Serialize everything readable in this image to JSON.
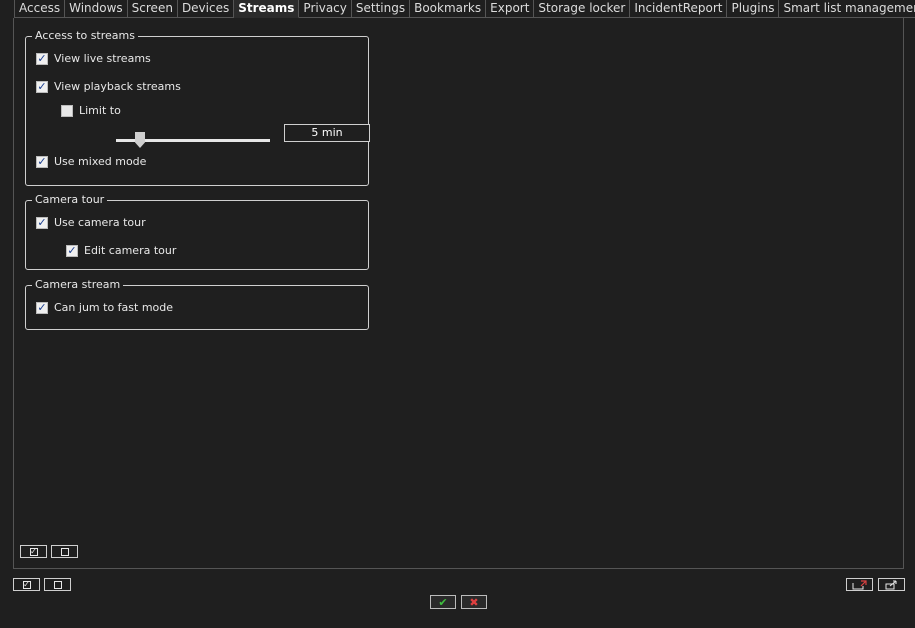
{
  "tabs": [
    {
      "label": "Access"
    },
    {
      "label": "Windows"
    },
    {
      "label": "Screen"
    },
    {
      "label": "Devices"
    },
    {
      "label": "Streams",
      "active": true
    },
    {
      "label": "Privacy"
    },
    {
      "label": "Settings"
    },
    {
      "label": "Bookmarks"
    },
    {
      "label": "Export"
    },
    {
      "label": "Storage locker"
    },
    {
      "label": "IncidentReport"
    },
    {
      "label": "Plugins"
    },
    {
      "label": "Smart list management"
    }
  ],
  "groups": {
    "access_to_streams": {
      "title": "Access to streams",
      "view_live": {
        "label": "View live streams",
        "checked": true
      },
      "view_playback": {
        "label": "View playback streams",
        "checked": true
      },
      "limit_to": {
        "label": "Limit to",
        "checked": false
      },
      "limit_value": "5 min",
      "mixed_mode": {
        "label": "Use mixed mode",
        "checked": true
      }
    },
    "camera_tour": {
      "title": "Camera tour",
      "use_tour": {
        "label": "Use camera tour",
        "checked": true
      },
      "edit_tour": {
        "label": "Edit camera tour",
        "checked": true
      }
    },
    "camera_stream": {
      "title": "Camera stream",
      "fast_mode": {
        "label": "Can jum to fast mode",
        "checked": true
      }
    }
  },
  "icons": {
    "ok": "checkmark-icon",
    "cancel": "close-icon"
  },
  "colors": {
    "background": "#1f1f1f",
    "ok": "#3fbf3f",
    "cancel": "#e04040"
  }
}
